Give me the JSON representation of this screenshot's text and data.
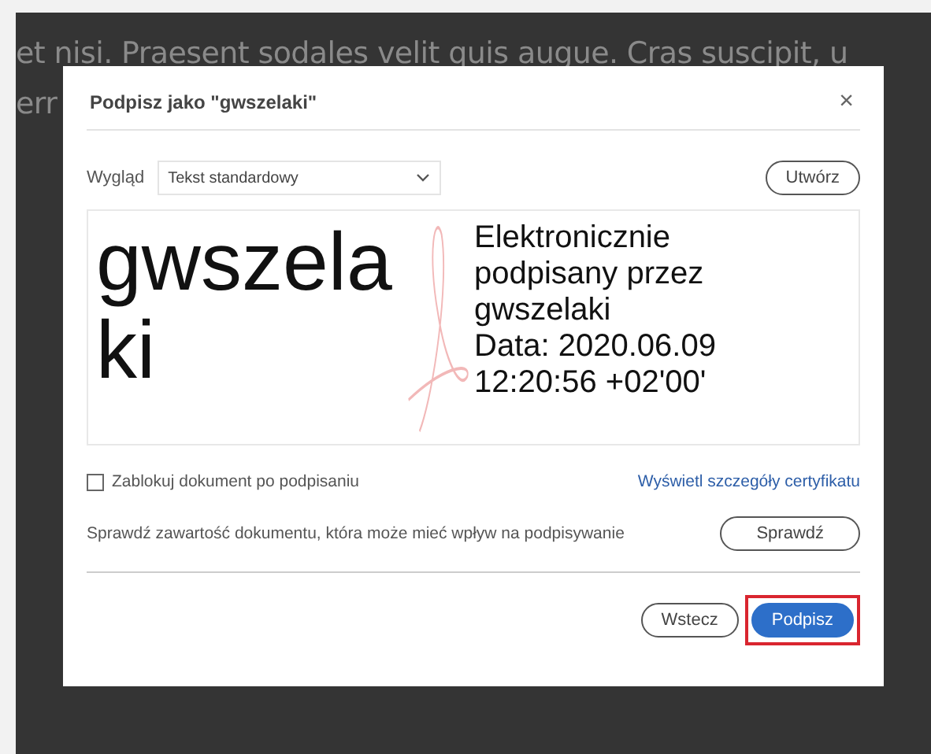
{
  "document": {
    "lines": [
      "et nisi. Praesent sodales velit quis augue. Cras suscipit, u",
      "err"
    ]
  },
  "dialog": {
    "title": "Podpisz jako \"gwszelaki\"",
    "close": "×",
    "appearance": {
      "label": "Wygląd",
      "value": "Tekst standardowy",
      "create_button": "Utwórz"
    },
    "preview": {
      "name": "gwszelaki",
      "details": [
        "Elektronicznie",
        "podpisany przez",
        "gwszelaki",
        "Data: 2020.06.09",
        "12:20:56 +02'00'"
      ]
    },
    "lock": {
      "label": "Zablokuj dokument po podpisaniu",
      "checked": false
    },
    "certificate_link": "Wyświetl szczegóły certyfikatu",
    "check": {
      "text": "Sprawdź zawartość dokumentu, która może mieć wpływ na podpisywanie",
      "button": "Sprawdź"
    },
    "buttons": [
      {
        "label": "Wstecz",
        "kind": "secondary",
        "highlighted": false
      },
      {
        "label": "Podpisz",
        "kind": "primary",
        "highlighted": true
      }
    ]
  }
}
